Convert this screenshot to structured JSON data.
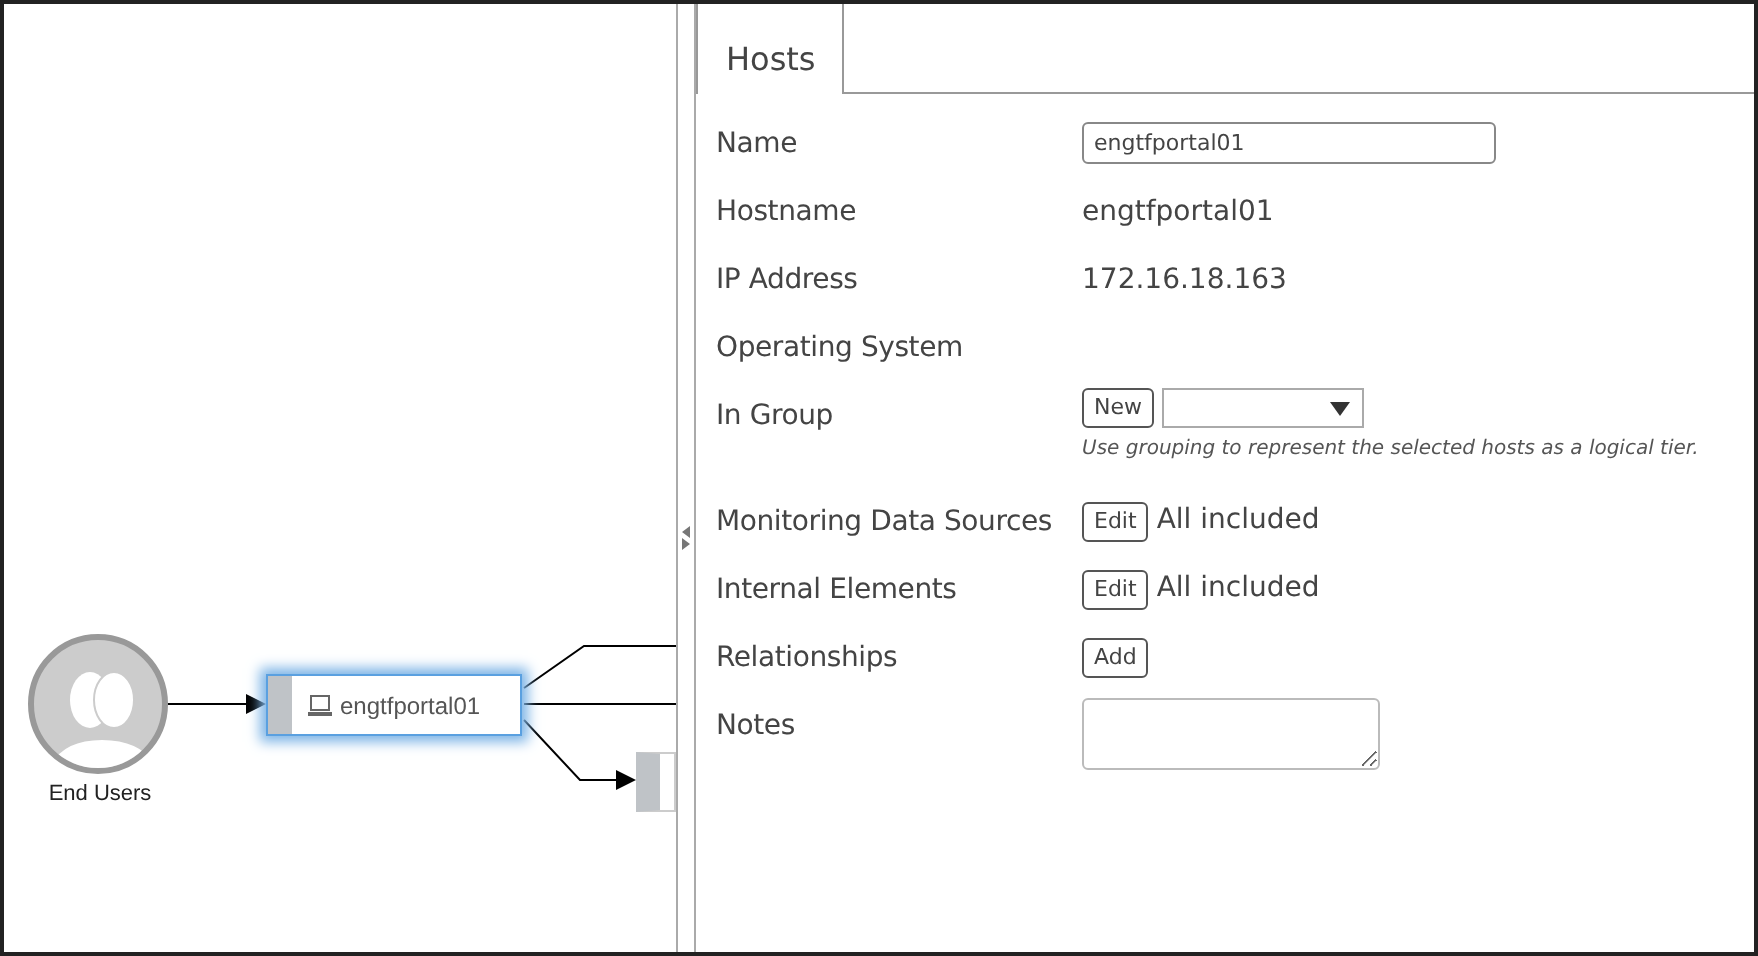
{
  "diagram": {
    "nodes": [
      {
        "kind": "users",
        "label": "End Users"
      },
      {
        "kind": "host",
        "label": "engtfportal01",
        "selected": true
      },
      {
        "kind": "stub"
      }
    ]
  },
  "panel": {
    "tabs": [
      {
        "label": "Hosts",
        "selected": true
      }
    ],
    "fields": [
      {
        "kind": "input",
        "label": "Name",
        "value": "engtfportal01"
      },
      {
        "kind": "text",
        "label": "Hostname",
        "value": "engtfportal01"
      },
      {
        "kind": "text",
        "label": "IP Address",
        "value": "172.16.18.163"
      },
      {
        "kind": "empty",
        "label": "Operating System"
      },
      {
        "kind": "group",
        "label": "In Group",
        "button": "New",
        "hint": "Use grouping to represent the selected hosts as a logical tier."
      },
      {
        "kind": "button-text",
        "label": "Monitoring Data Sources",
        "button": "Edit",
        "value": "All included"
      },
      {
        "kind": "button-text",
        "label": "Internal Elements",
        "button": "Edit",
        "value": "All included"
      },
      {
        "kind": "button",
        "label": "Relationships",
        "button": "Add"
      },
      {
        "kind": "textarea",
        "label": "Notes"
      }
    ]
  }
}
